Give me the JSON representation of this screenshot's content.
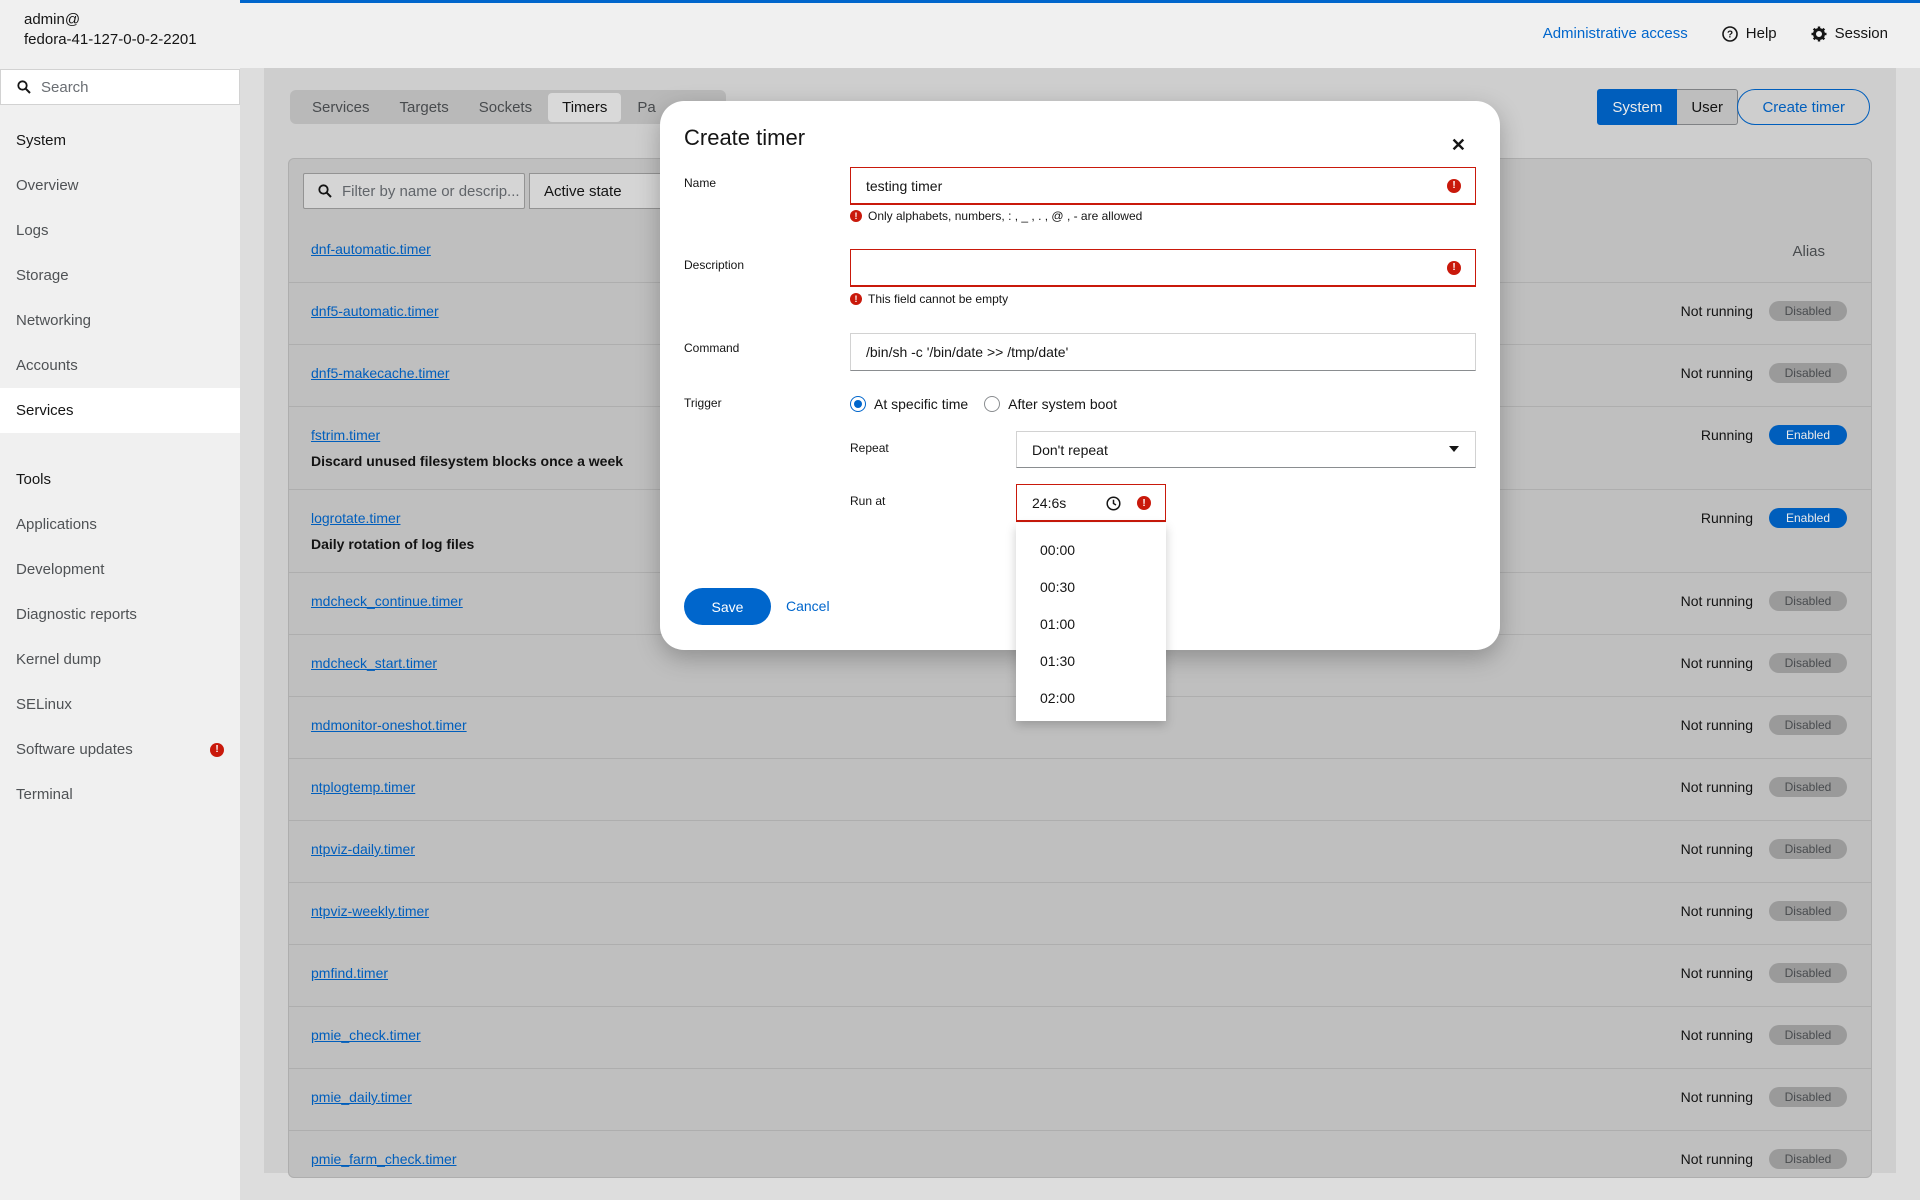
{
  "host": {
    "user": "admin@",
    "name": "fedora-41-127-0-0-2-2201"
  },
  "search": {
    "placeholder": "Search"
  },
  "nav": {
    "system_label": "System",
    "system_items": [
      "Overview",
      "Logs",
      "Storage",
      "Networking",
      "Accounts",
      "Services"
    ],
    "active": "Services",
    "tools_label": "Tools",
    "tools_items": [
      "Applications",
      "Development",
      "Diagnostic reports",
      "Kernel dump",
      "SELinux",
      "Software updates",
      "Terminal"
    ],
    "alert_item": "Software updates"
  },
  "topbar": {
    "admin": "Administrative access",
    "help": "Help",
    "session": "Session"
  },
  "tabs": [
    "Services",
    "Targets",
    "Sockets",
    "Timers",
    "Pa"
  ],
  "active_tab": "Timers",
  "scope": {
    "system": "System",
    "user": "User"
  },
  "create_timer": "Create timer",
  "filter": {
    "placeholder": "Filter by name or descrip...",
    "active_state": "Active state"
  },
  "alias_header": "Alias",
  "rows": [
    {
      "unit": "dnf-automatic.timer",
      "desc": "",
      "status": "",
      "badge": ""
    },
    {
      "unit": "dnf5-automatic.timer",
      "desc": "",
      "status": "Not running",
      "badge": "Disabled"
    },
    {
      "unit": "dnf5-makecache.timer",
      "desc": "",
      "status": "Not running",
      "badge": "Disabled"
    },
    {
      "unit": "fstrim.timer",
      "desc": "Discard unused filesystem blocks once a week",
      "status": "Running",
      "badge": "Enabled"
    },
    {
      "unit": "logrotate.timer",
      "desc": "Daily rotation of log files",
      "status": "Running",
      "badge": "Enabled"
    },
    {
      "unit": "mdcheck_continue.timer",
      "desc": "",
      "status": "Not running",
      "badge": "Disabled"
    },
    {
      "unit": "mdcheck_start.timer",
      "desc": "",
      "status": "Not running",
      "badge": "Disabled"
    },
    {
      "unit": "mdmonitor-oneshot.timer",
      "desc": "",
      "status": "Not running",
      "badge": "Disabled"
    },
    {
      "unit": "ntplogtemp.timer",
      "desc": "",
      "status": "Not running",
      "badge": "Disabled"
    },
    {
      "unit": "ntpviz-daily.timer",
      "desc": "",
      "status": "Not running",
      "badge": "Disabled"
    },
    {
      "unit": "ntpviz-weekly.timer",
      "desc": "",
      "status": "Not running",
      "badge": "Disabled"
    },
    {
      "unit": "pmfind.timer",
      "desc": "",
      "status": "Not running",
      "badge": "Disabled"
    },
    {
      "unit": "pmie_check.timer",
      "desc": "",
      "status": "Not running",
      "badge": "Disabled"
    },
    {
      "unit": "pmie_daily.timer",
      "desc": "",
      "status": "Not running",
      "badge": "Disabled"
    },
    {
      "unit": "pmie_farm_check.timer",
      "desc": "",
      "status": "Not running",
      "badge": "Disabled"
    }
  ],
  "modal": {
    "title": "Create timer",
    "name_label": "Name",
    "name_value": "testing timer",
    "name_error": "Only alphabets, numbers, : , _ , . , @ , - are allowed",
    "description_label": "Description",
    "description_value": "",
    "description_error": "This field cannot be empty",
    "command_label": "Command",
    "command_value": "/bin/sh -c '/bin/date >> /tmp/date'",
    "trigger_label": "Trigger",
    "trigger_options": [
      "At specific time",
      "After system boot"
    ],
    "trigger_selected": "At specific time",
    "repeat_label": "Repeat",
    "repeat_value": "Don't repeat",
    "run_at_label": "Run at",
    "run_at_value": "24:6s",
    "time_options": [
      "00:00",
      "00:30",
      "01:00",
      "01:30",
      "02:00"
    ],
    "save": "Save",
    "cancel": "Cancel"
  },
  "colors": {
    "accent": "#0066cc",
    "danger": "#c9190b"
  }
}
